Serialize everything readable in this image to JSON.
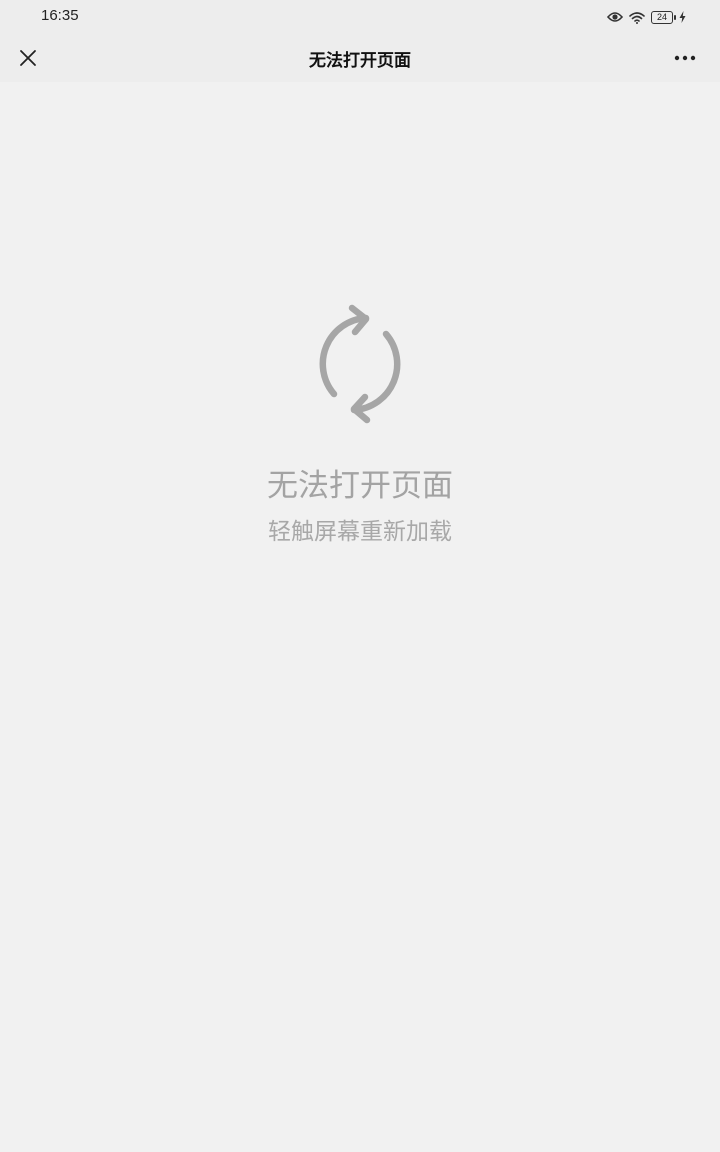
{
  "status_bar": {
    "time": "16:35",
    "battery_level": "24",
    "icons": [
      "eye-icon",
      "wifi-icon",
      "battery-icon",
      "charging-bolt-icon"
    ]
  },
  "nav": {
    "title": "无法打开页面",
    "close_icon": "close-icon",
    "more_icon": "more-dots-icon"
  },
  "error": {
    "icon": "reload-icon",
    "title": "无法打开页面",
    "subtitle": "轻触屏幕重新加载"
  },
  "colors": {
    "background": "#f1f1f1",
    "bar_background": "#ededed",
    "muted_text": "#a3a3a3",
    "icon_gray": "#a6a6a6"
  }
}
